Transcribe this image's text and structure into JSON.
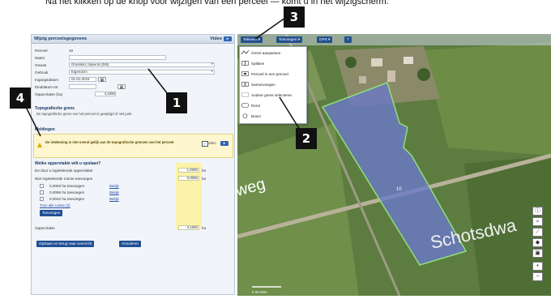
{
  "intro_text": "Na het klikken op de knop voor wijzigen van een perceel — komt u in het wijzigscherm:",
  "panel": {
    "title": "Wijzig perceelsgegevens",
    "video_label": "Video",
    "fields": [
      {
        "label": "Perceel",
        "value": "10"
      },
      {
        "label": "Naam",
        "value": ""
      },
      {
        "label": "Gewas",
        "value": "Grasland, blijvend (265)"
      },
      {
        "label": "Gebruik",
        "value": "Eigendom"
      },
      {
        "label": "Ingangsdatum",
        "value": "01-01-2016"
      },
      {
        "label": "Einddatum tot",
        "value": ""
      },
      {
        "label": "Oppervlakte (ha)",
        "value": "4,1550"
      }
    ],
    "grens_title": "Topografische grens",
    "grens_text": "De topografische grens van het perceel is gewijzigd of niet juist.",
    "meldingen_title": "Meldingen",
    "melding_text": "De intekening is niet overal gelijk aan de topografische grenzen van het perceel.",
    "opp_question": "Welke oppervlakte wilt u opslaan?",
    "opp_rows": [
      {
        "label": "De door u ingetekende oppervlakte",
        "value": "1,0300",
        "unit": "ha"
      },
      {
        "label": "Niet ingetekende ruimte toevoegen",
        "value": "0,0056",
        "unit": "ha"
      }
    ],
    "add_rows": [
      {
        "label": "0,0083 ha toevoegen",
        "link": "Bekijk"
      },
      {
        "label": "0,0056 ha toevoegen",
        "link": "Bekijk"
      },
      {
        "label": "0,0042 ha toevoegen",
        "link": "Bekijk"
      }
    ],
    "toon_link": "Toon alle ruimte (3)",
    "toevoegen_button": "Toevoegen",
    "total_label": "Oppervlakte",
    "total_value": "4,1550",
    "total_unit": "ha",
    "opslaan_button": "Opslaan en terug naar overzicht",
    "annuleren_button": "Annuleren"
  },
  "map": {
    "toolbar": {
      "tekenen_label": "Tekenen",
      "toevoegen_label": "Toevoegen",
      "gps_label": "GPS",
      "help_label": "?"
    },
    "dropdown_items": [
      {
        "label": "Grens aanpassen",
        "icon": "edit-border-icon"
      },
      {
        "label": "Splitsen",
        "icon": "split-icon"
      },
      {
        "label": "Perceel in een perceel",
        "icon": "nested-parcel-icon"
      },
      {
        "label": "Samenvoegen",
        "icon": "merge-icon"
      },
      {
        "label": "Andere grens selecteren",
        "icon": "select-border-icon"
      },
      {
        "label": "Rond",
        "icon": "round-icon"
      },
      {
        "label": "Boom",
        "icon": "tree-icon"
      }
    ],
    "street_labels": [
      "weg",
      "Schotsdwa"
    ],
    "parcel_number": "10",
    "scale_label": "0     25    50m",
    "zoom_in": "+",
    "zoom_out": "−"
  },
  "callouts": [
    "1",
    "2",
    "3",
    "4"
  ],
  "colors": {
    "brand_blue": "#1f4f95",
    "warning_yellow": "#fdf6cf",
    "parcel_fill": "#6a78c8",
    "parcel_border": "#8fe07a"
  }
}
